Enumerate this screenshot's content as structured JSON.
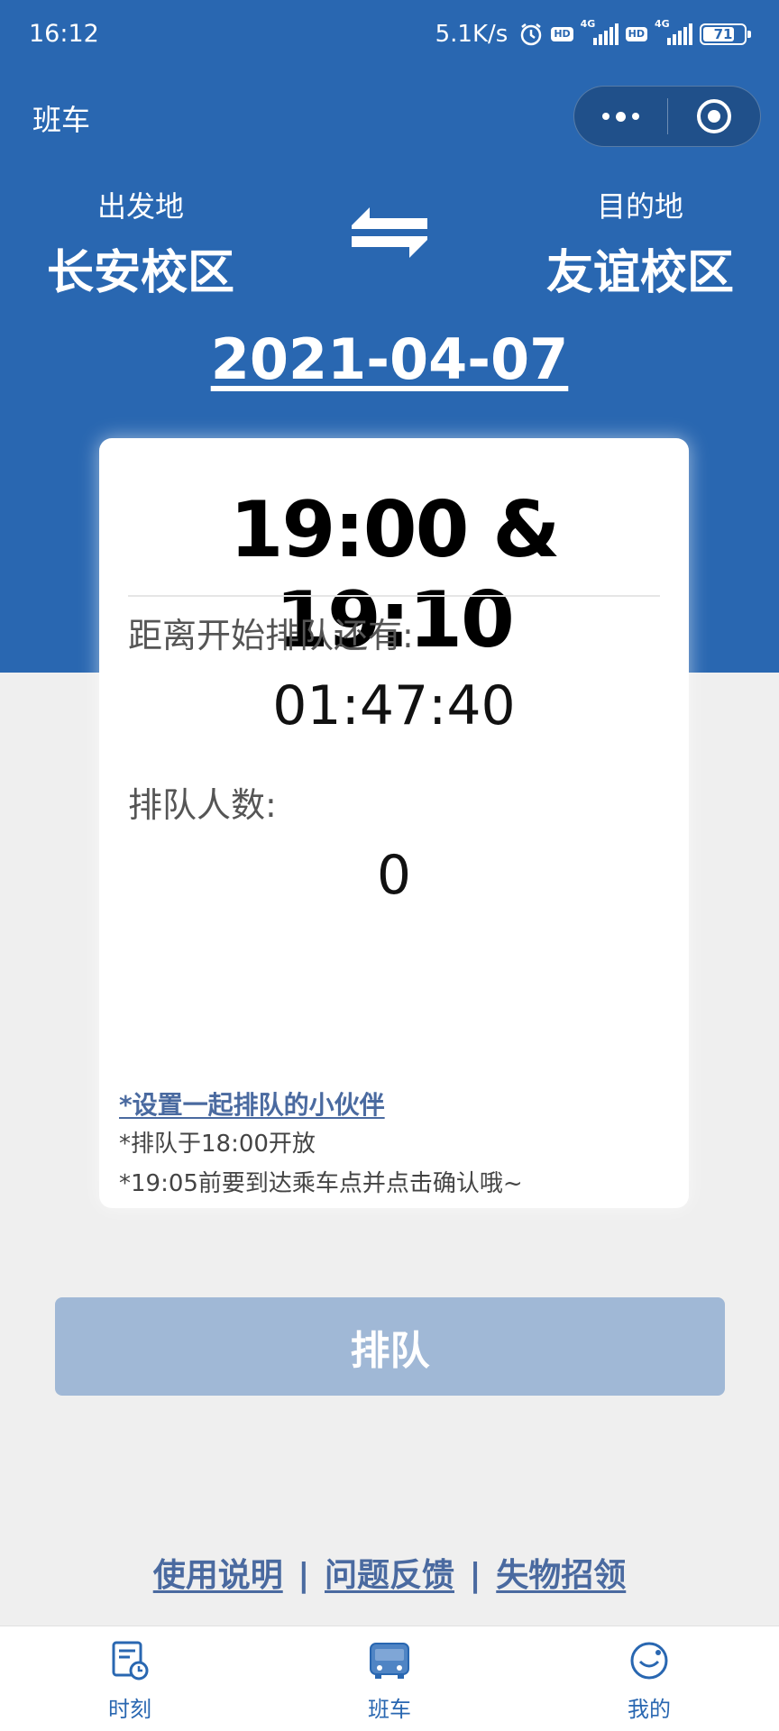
{
  "status_bar": {
    "time": "16:12",
    "net_speed": "5.1K/s",
    "hd": "HD",
    "network": "4G",
    "battery": "71"
  },
  "nav": {
    "title": "班车"
  },
  "route": {
    "from_label": "出发地",
    "from_name": "长安校区",
    "to_label": "目的地",
    "to_name": "友谊校区"
  },
  "date": "2021-04-07",
  "card": {
    "times": "19:00 & 19:10",
    "countdown_label": "距离开始排队还有:",
    "countdown_value": "01:47:40",
    "queue_label": "排队人数:",
    "queue_value": "0",
    "partner_link": "*设置一起排队的小伙伴",
    "note_1": "*排队于18:00开放",
    "note_2": "*19:05前要到达乘车点并点击确认哦~"
  },
  "queue_button": "排队",
  "footer_links": {
    "manual": "使用说明",
    "feedback": "问题反馈",
    "lost_found": "失物招领",
    "separator": "|"
  },
  "tabs": [
    {
      "label": "时刻",
      "icon": "schedule-icon"
    },
    {
      "label": "班车",
      "icon": "bus-icon"
    },
    {
      "label": "我的",
      "icon": "profile-icon"
    }
  ],
  "colors": {
    "primary": "#2967b1",
    "button_disabled": "#a0b8d6",
    "link": "#4a6aa0",
    "background": "#efefef"
  }
}
